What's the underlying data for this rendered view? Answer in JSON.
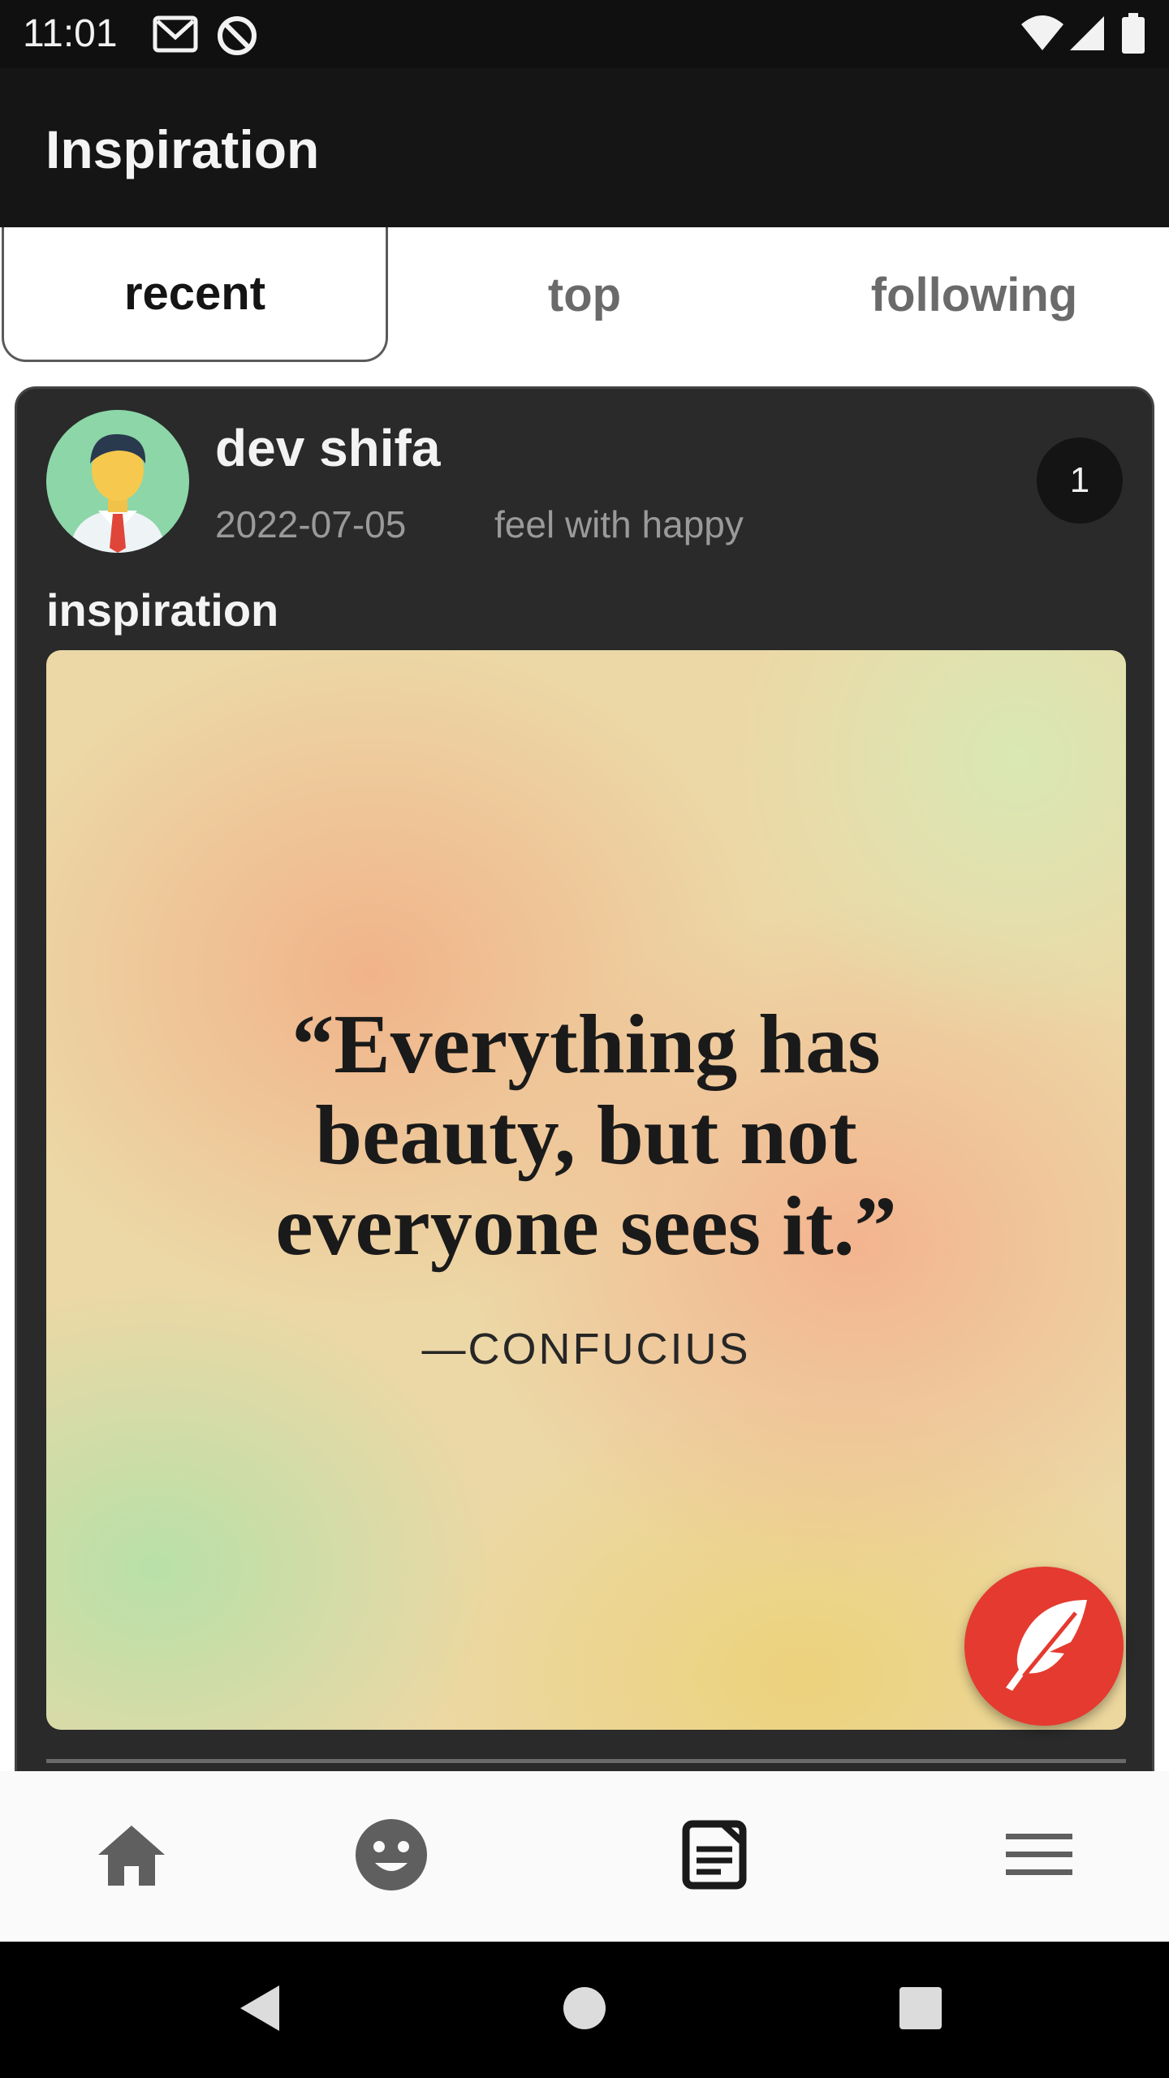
{
  "status_bar": {
    "time": "11:01"
  },
  "app_bar": {
    "title": "Inspiration"
  },
  "tabs": [
    {
      "label": "recent",
      "selected": true
    },
    {
      "label": "top",
      "selected": false
    },
    {
      "label": "following",
      "selected": false
    }
  ],
  "post": {
    "author": "dev shifa",
    "date": "2022-07-05",
    "mood": "feel with happy",
    "count": "1",
    "title": "inspiration",
    "image_quote": "“Everything has beauty, but not everyone sees it.”",
    "image_quote_author": "—CONFUCIUS"
  },
  "fab": {
    "icon": "feather-icon",
    "color": "#e53a2f"
  },
  "bottom_nav": {
    "items": [
      {
        "icon": "home-icon",
        "active": false
      },
      {
        "icon": "smiley-icon",
        "active": false
      },
      {
        "icon": "document-icon",
        "active": true
      },
      {
        "icon": "menu-icon",
        "active": false
      }
    ]
  },
  "system_nav": {
    "items": [
      "back-icon",
      "home-circle-icon",
      "recents-icon"
    ]
  }
}
